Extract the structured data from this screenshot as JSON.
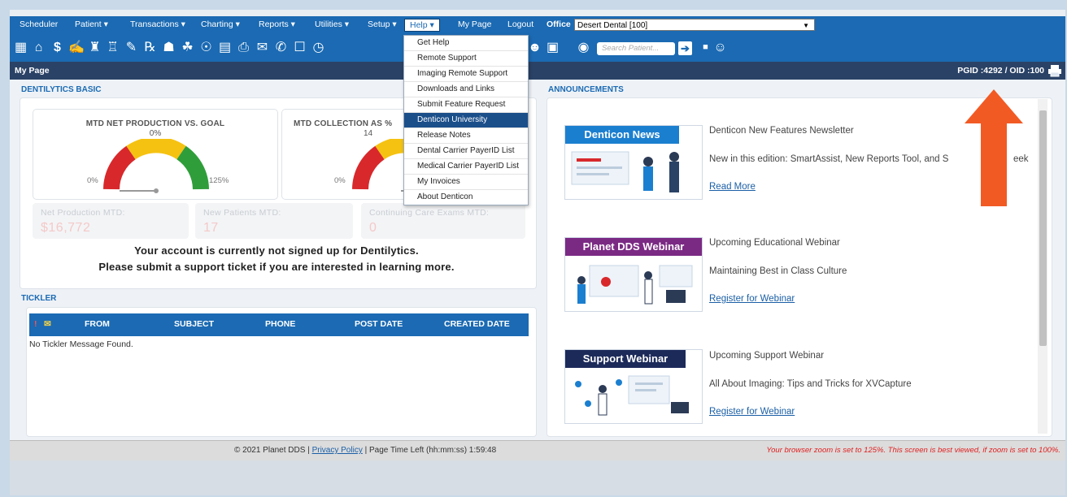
{
  "menubar": {
    "items": [
      "Scheduler",
      "Patient",
      "Transactions",
      "Charting",
      "Reports",
      "Utilities",
      "Setup",
      "Help",
      "My Page",
      "Logout"
    ],
    "office_label": "Office",
    "office_value": "Desert Dental [100]"
  },
  "toolbar": {
    "search_placeholder": "Search Patient..."
  },
  "titlebar": {
    "title": "My Page",
    "ids": "PGID :4292 / OID :100"
  },
  "dentilytics": {
    "title": "DENTILYTICS BASIC",
    "gauge1": {
      "title": "MTD NET PRODUCTION VS. GOAL",
      "pct": "0%",
      "min": "0%",
      "max": "125%",
      "value": 0
    },
    "gauge2": {
      "title": "MTD COLLECTION AS %",
      "pct": "14",
      "min": "0%"
    },
    "stats": [
      {
        "label": "Net Production MTD:",
        "value": "$16,772"
      },
      {
        "label": "New Patients MTD:",
        "value": "17"
      },
      {
        "label": "Continuing Care Exams MTD:",
        "value": "0"
      }
    ],
    "notice_line1": "Your account is currently not signed up for Dentilytics.",
    "notice_line2": "Please submit a support ticket if you are interested in learning more."
  },
  "tickler": {
    "title": "TICKLER",
    "flag": "!",
    "columns": [
      "FROM",
      "SUBJECT",
      "PHONE",
      "POST DATE",
      "CREATED DATE"
    ],
    "empty": "No Tickler Message Found."
  },
  "announcements": {
    "title": "ANNOUNCEMENTS",
    "items": [
      {
        "banner": "Denticon News",
        "heading": "Denticon New Features Newsletter",
        "desc": "New in this edition: SmartAssist, New Reports Tool, and S",
        "desc_tail": "eek",
        "link": "Read More"
      },
      {
        "banner": "Planet DDS Webinar",
        "heading": "Upcoming Educational Webinar",
        "desc": "Maintaining Best in Class Culture",
        "link": "Register for Webinar"
      },
      {
        "banner": "Support Webinar",
        "heading": "Upcoming Support Webinar",
        "desc": "All About Imaging: Tips and Tricks for XVCapture",
        "link": "Register for Webinar"
      }
    ]
  },
  "help_menu": {
    "items": [
      "Get Help",
      "Remote Support",
      "Imaging Remote Support",
      "Downloads and Links",
      "Submit Feature Request",
      "Denticon University",
      "Release Notes",
      "Dental Carrier PayerID List",
      "Medical Carrier PayerID List",
      "My Invoices",
      "About Denticon"
    ],
    "selected_index": 5
  },
  "footer": {
    "copyright": "© 2021 Planet DDS |",
    "privacy": "Privacy Policy",
    "time_left": "| Page Time Left (hh:mm:ss) 1:59:48",
    "zoom_warning": "Your browser zoom is set to 125%. This screen is best viewed, if zoom is set to 100%."
  },
  "colors": {
    "menu_blue": "#1b6ab3",
    "title_navy": "#2a4266",
    "arrow": "#f25a24",
    "selected": "#1b4f8a"
  }
}
